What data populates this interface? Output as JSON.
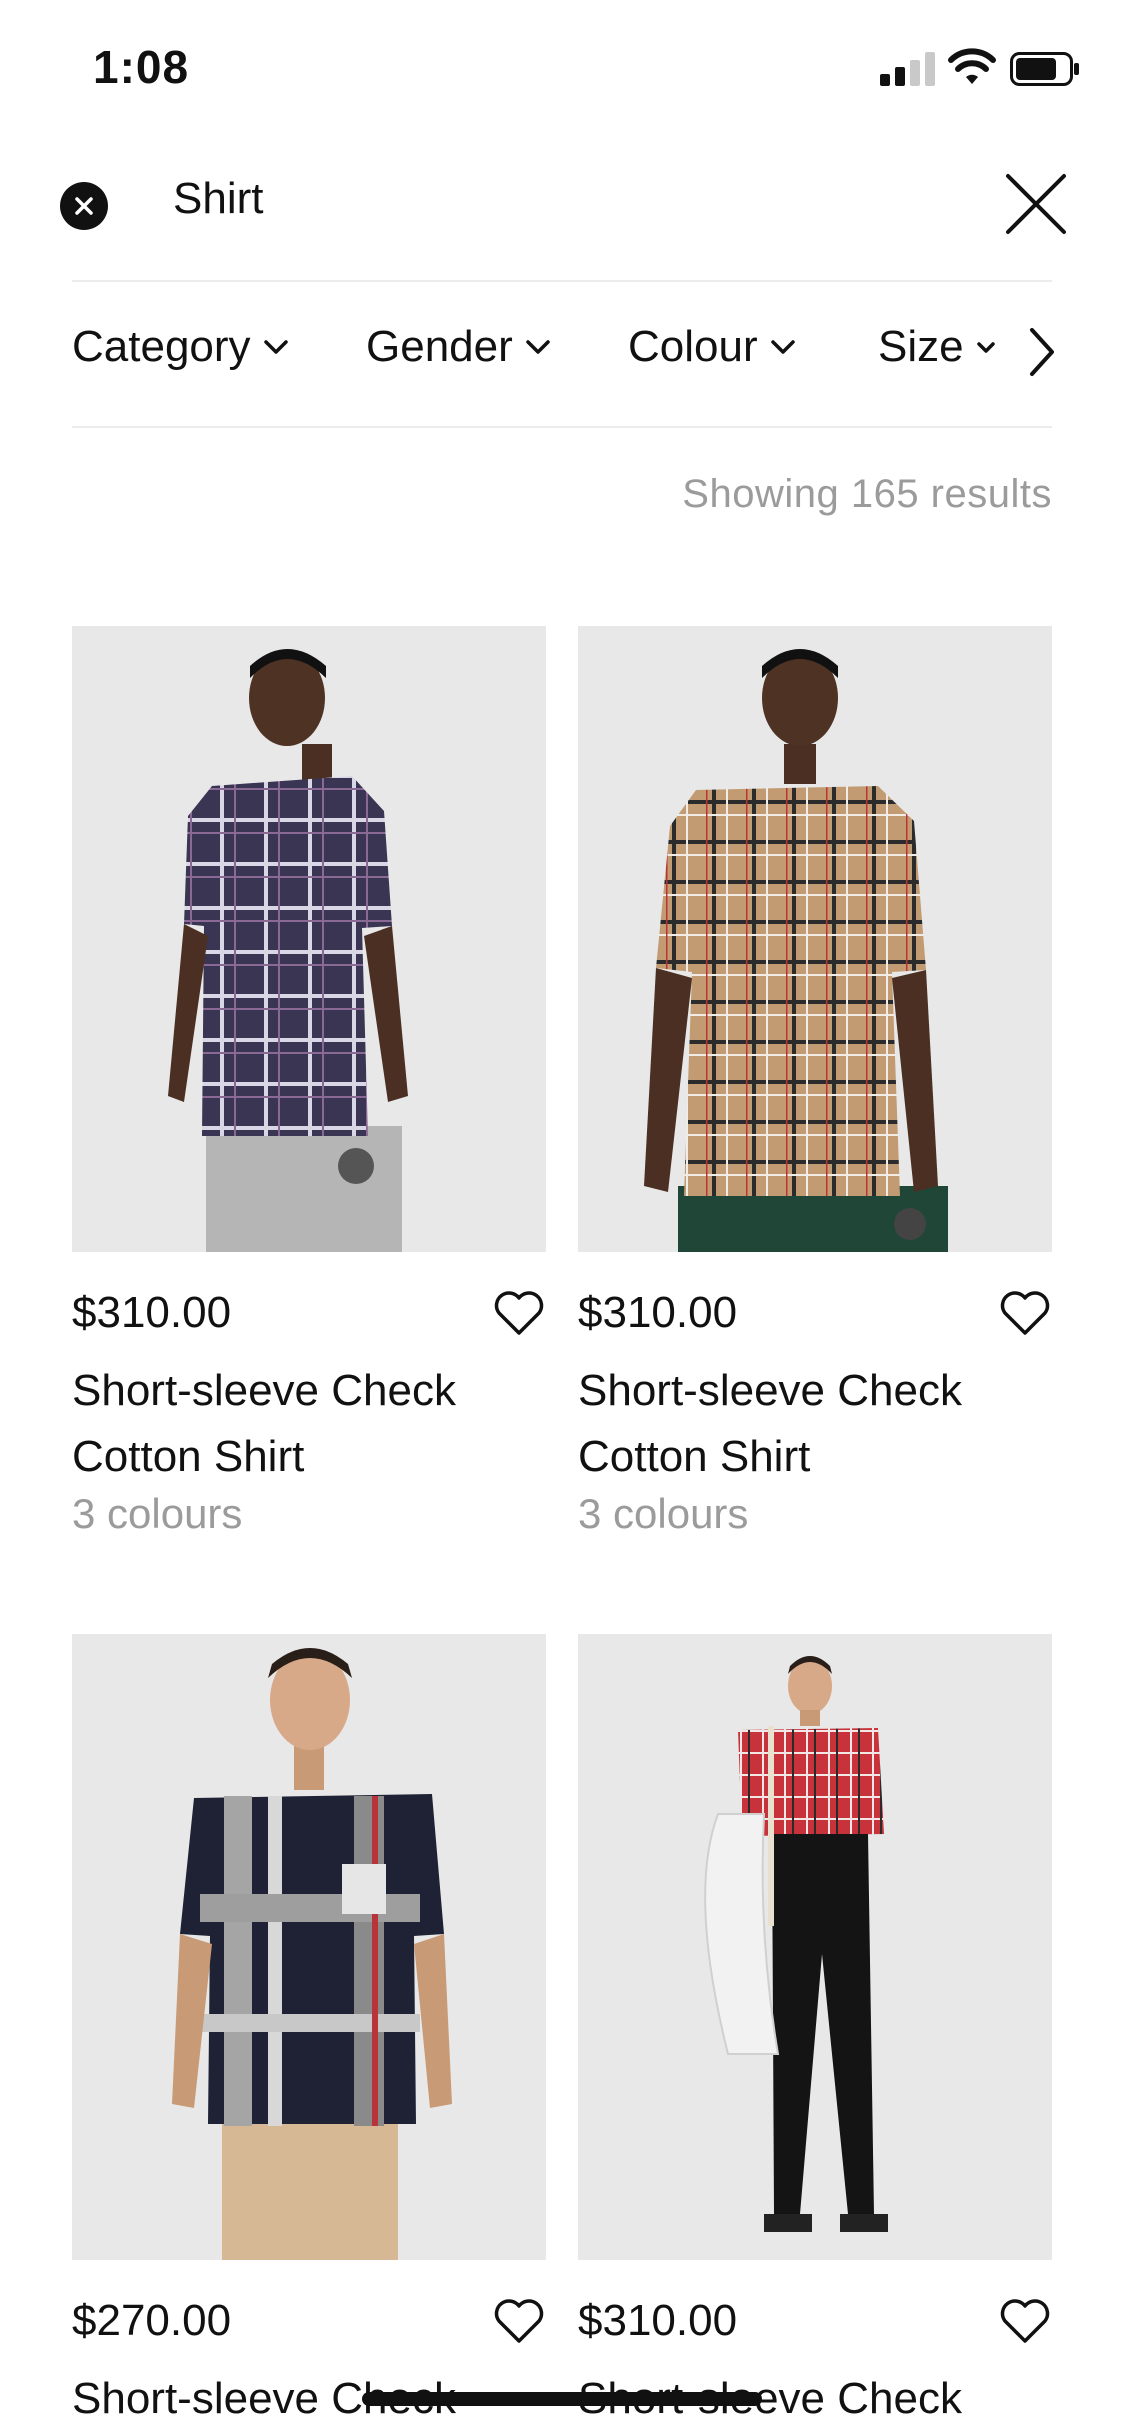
{
  "status_bar": {
    "time": "1:08"
  },
  "search": {
    "query": "Shirt"
  },
  "filters": [
    {
      "label": "Category"
    },
    {
      "label": "Gender"
    },
    {
      "label": "Colour"
    },
    {
      "label": "Size"
    }
  ],
  "results": {
    "text": "Showing 165 results"
  },
  "products": [
    {
      "price": "$310.00",
      "name": "Short-sleeve Check Cotton Shirt",
      "colours": "3 colours"
    },
    {
      "price": "$310.00",
      "name": "Short-sleeve Check Cotton Shirt",
      "colours": "3 colours"
    },
    {
      "price": "$270.00",
      "name": "Short-sleeve Check"
    },
    {
      "price": "$310.00",
      "name": "Short-sleeve Check"
    }
  ],
  "colors": {
    "text": "#111111",
    "muted": "#9b9b9b",
    "divider": "#ececec",
    "image_bg": "#e9e9e9"
  }
}
